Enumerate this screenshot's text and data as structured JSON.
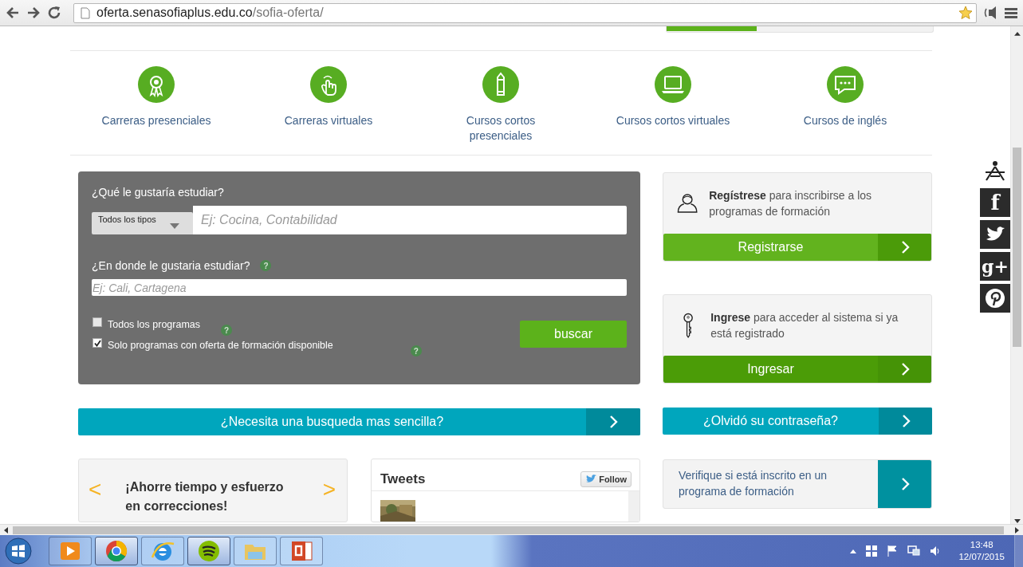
{
  "browser": {
    "url_host": "oferta.senasofiaplus.edu.co",
    "url_path": "/sofia-oferta/"
  },
  "categories": [
    {
      "kind": "medal",
      "label": "Carreras presenciales"
    },
    {
      "kind": "hand",
      "label": "Carreras virtuales"
    },
    {
      "kind": "pencil",
      "label": "Cursos cortos presenciales"
    },
    {
      "kind": "laptop",
      "label": "Cursos cortos virtuales"
    },
    {
      "kind": "chat",
      "label": "Cursos de inglés"
    }
  ],
  "search": {
    "what_label": "¿Qué le gustaría estudiar?",
    "type_select": "Todos los tipos",
    "what_placeholder": "Ej: Cocina, Contabilidad",
    "where_label": "¿En donde le gustaria estudiar?",
    "where_help": "?",
    "where_placeholder": "Ej: Cali, Cartagena",
    "options": [
      {
        "label": "Todos los programas",
        "checked": false,
        "help": "?"
      },
      {
        "label": "Solo programas con oferta de formación disponible",
        "checked": true,
        "help": "?"
      }
    ],
    "button": "buscar"
  },
  "simple_search": "¿Necesita una busqueda mas sencilla?",
  "carousel": {
    "prev": "<",
    "text": "¡Ahorre tiempo y esfuerzo en correcciones!",
    "next": ">"
  },
  "tweets": {
    "title": "Tweets",
    "follow": "Follow"
  },
  "register": {
    "text": "**Regístrese** para inscribirse a los programas de formación",
    "button": "Registrarse"
  },
  "login": {
    "text": "**Ingrese** para acceder al sistema si ya está registrado",
    "button": "Ingresar"
  },
  "forgot": "¿Olvidó su contraseña?",
  "verify": "Verifique si está inscrito en un programa de formación",
  "social": [
    {
      "kind": "sena"
    },
    {
      "kind": "facebook",
      "glyph": "f"
    },
    {
      "kind": "twitter"
    },
    {
      "kind": "googleplus",
      "glyph": "g+"
    },
    {
      "kind": "pinterest"
    }
  ],
  "taskbar": {
    "apps": [
      {
        "kind": "media",
        "active": false
      },
      {
        "kind": "chrome",
        "active": true
      },
      {
        "kind": "ie",
        "active": false
      },
      {
        "kind": "spotify",
        "active": true
      },
      {
        "kind": "folder",
        "active": false
      },
      {
        "kind": "powerpoint",
        "active": false
      }
    ],
    "time": "13:48",
    "date": "12/07/2015"
  }
}
